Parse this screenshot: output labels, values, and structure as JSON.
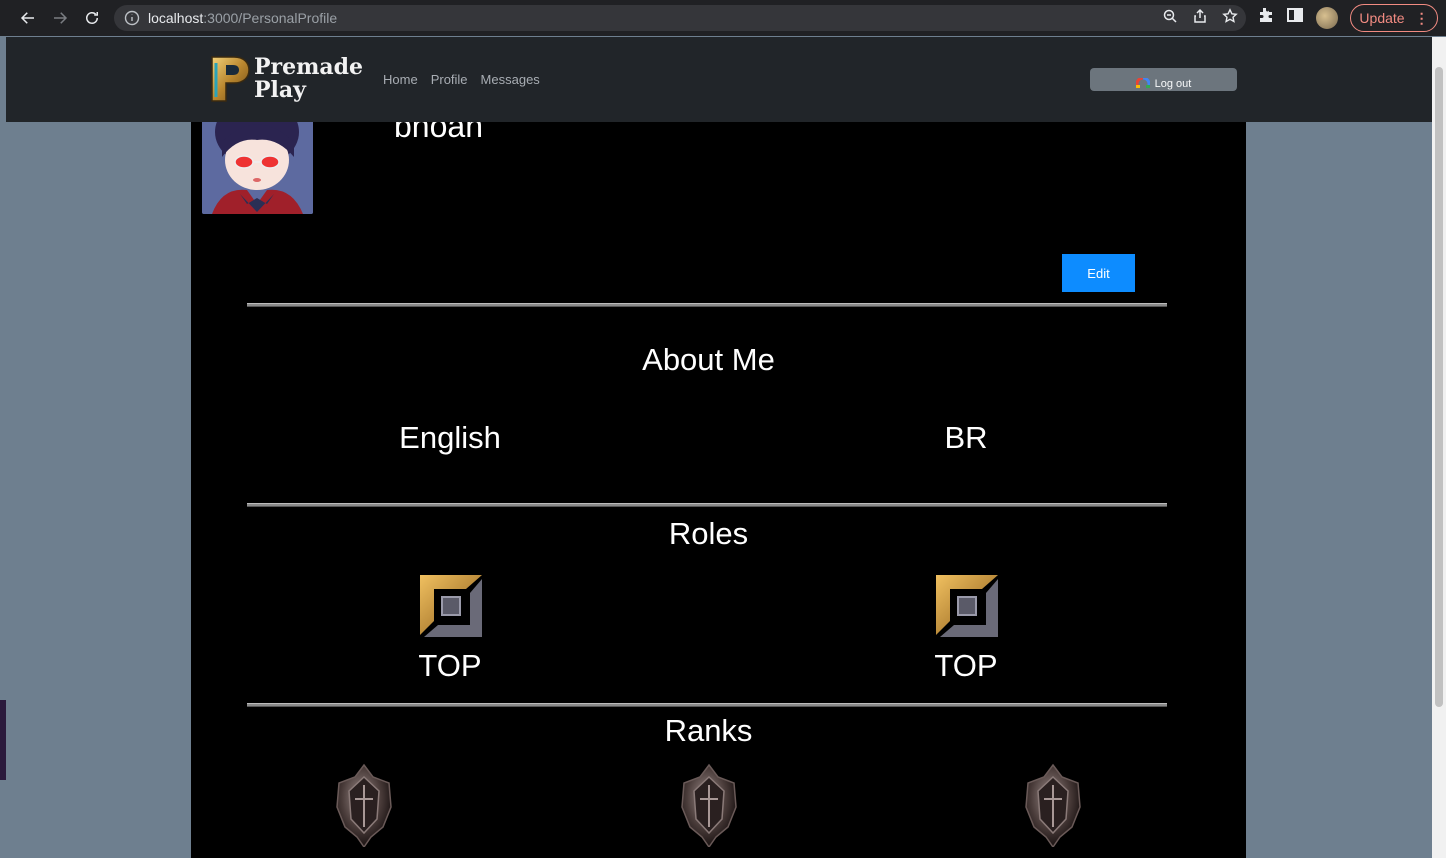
{
  "browser": {
    "url_host": "localhost",
    "url_path": ":3000/PersonalProfile",
    "update_label": "Update",
    "menu_glyph": "⋮"
  },
  "navbar": {
    "logo_line1": "Premade",
    "logo_line2": "Play",
    "links": [
      "Home",
      "Profile",
      "Messages"
    ],
    "logout_label": "Log out"
  },
  "profile": {
    "username": "bnoan",
    "edit_label": "Edit"
  },
  "about": {
    "title": "About Me",
    "language": "English",
    "region": "BR"
  },
  "roles": {
    "title": "Roles",
    "items": [
      "TOP",
      "TOP"
    ]
  },
  "ranks": {
    "title": "Ranks"
  },
  "colors": {
    "page_bg": "#6e7f8f",
    "panel_bg": "#000000",
    "navbar_bg": "#212529",
    "edit_button": "#0d8cff",
    "logout_button": "#6c757d"
  }
}
